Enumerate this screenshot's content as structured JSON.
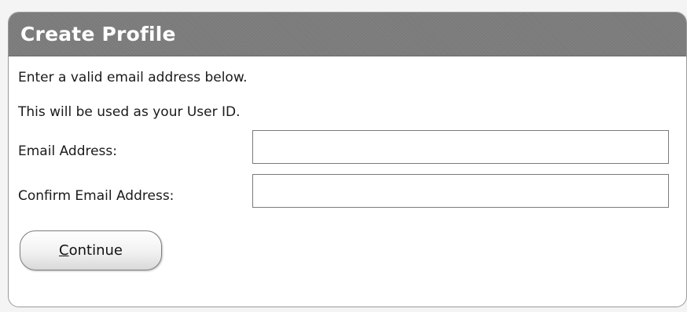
{
  "panel": {
    "title": "Create Profile"
  },
  "intro": {
    "line1": "Enter a valid email address below.",
    "line2": "This will be used as your User ID."
  },
  "form": {
    "email_label": "Email Address:",
    "email_value": "",
    "confirm_label": "Confirm Email Address:",
    "confirm_value": ""
  },
  "actions": {
    "continue_mnemonic": "C",
    "continue_rest": "ontinue"
  },
  "colors": {
    "header_bg": "#7a7a7a",
    "header_text": "#ffffff",
    "page_bg": "#f4f4f4"
  }
}
